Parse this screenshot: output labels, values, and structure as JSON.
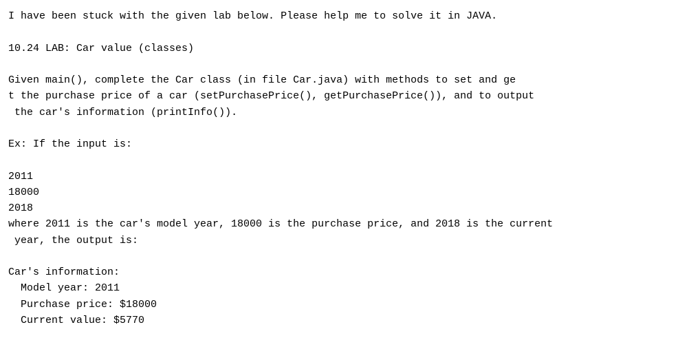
{
  "lines": [
    "I have been stuck with the given lab below. Please help me to solve it in JAVA.",
    "",
    "10.24 LAB: Car value (classes)",
    "",
    "Given main(), complete the Car class (in file Car.java) with methods to set and ge",
    "t the purchase price of a car (setPurchasePrice(), getPurchasePrice()), and to output",
    " the car's information (printInfo()).",
    "",
    "Ex: If the input is:",
    "",
    "2011",
    "18000",
    "2018",
    "where 2011 is the car's model year, 18000 is the purchase price, and 2018 is the current",
    " year, the output is:",
    "",
    "Car's information:"
  ],
  "indented_lines": [
    "Model year: 2011",
    "Purchase price: $18000",
    "Current value: $5770"
  ]
}
